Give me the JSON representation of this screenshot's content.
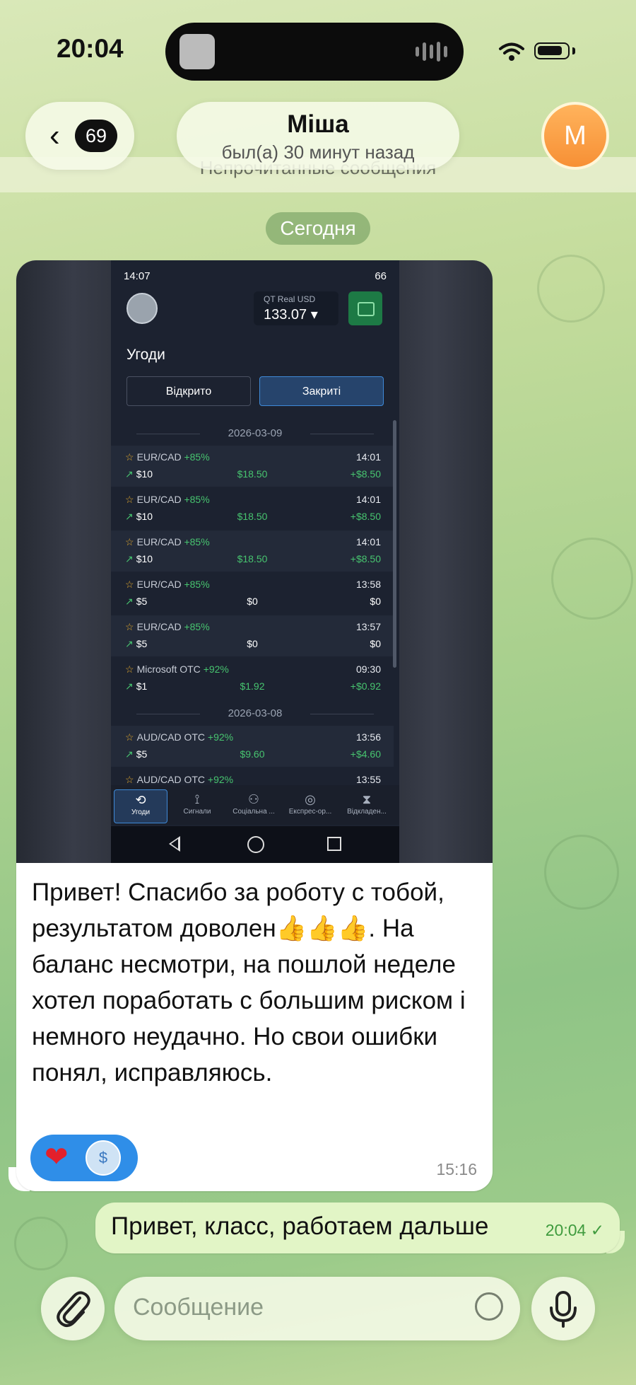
{
  "status_bar": {
    "time": "20:04"
  },
  "header": {
    "back_badge": "69",
    "contact_name": "Міша",
    "contact_status": "был(а) 30 минут назад",
    "avatar_letter": "M"
  },
  "unread_banner": "Непрочитанные сообщения",
  "date_separator": "Сегодня",
  "incoming_message": {
    "screenshot": {
      "status_time": "14:07",
      "status_right": "66",
      "account_label": "QT Real  USD",
      "account_balance": "133.07 ▾",
      "screen_title": "Угоди",
      "tab_open": "Відкрито",
      "tab_closed": "Закриті",
      "groups": [
        {
          "date": "2026-03-09"
        },
        {
          "date": "2026-03-08"
        }
      ],
      "trades": [
        {
          "asset": "EUR/CAD",
          "pct": "+85%",
          "time": "14:01",
          "amount": "$10",
          "payout": "$18.50",
          "profit": "+$8.50"
        },
        {
          "asset": "EUR/CAD",
          "pct": "+85%",
          "time": "14:01",
          "amount": "$10",
          "payout": "$18.50",
          "profit": "+$8.50"
        },
        {
          "asset": "EUR/CAD",
          "pct": "+85%",
          "time": "14:01",
          "amount": "$10",
          "payout": "$18.50",
          "profit": "+$8.50"
        },
        {
          "asset": "EUR/CAD",
          "pct": "+85%",
          "time": "13:58",
          "amount": "$5",
          "payout": "$0",
          "profit": "$0"
        },
        {
          "asset": "EUR/CAD",
          "pct": "+85%",
          "time": "13:57",
          "amount": "$5",
          "payout": "$0",
          "profit": "$0"
        },
        {
          "asset": "Microsoft OTC",
          "pct": "+92%",
          "time": "09:30",
          "amount": "$1",
          "payout": "$1.92",
          "profit": "+$0.92"
        },
        {
          "asset": "AUD/CAD OTC",
          "pct": "+92%",
          "time": "13:56",
          "amount": "$5",
          "payout": "$9.60",
          "profit": "+$4.60"
        },
        {
          "asset": "AUD/CAD OTC",
          "pct": "+92%",
          "time": "13:55",
          "amount": "",
          "payout": "",
          "profit": ""
        }
      ],
      "bottom_nav": [
        "Угоди",
        "Сигнали",
        "Соціальна ...",
        "Експрес-ор...",
        "Відкладен..."
      ]
    },
    "text": "Привет! Спасибо за роботу с тобой, результатом доволен👍👍👍. На баланс несмотри, на пошлой неделе хотел поработать с большим риском і немного неудачно. Но свои ошибки понял, исправляюсь.",
    "reaction": "❤",
    "time": "15:16"
  },
  "outgoing_message": {
    "text": "Привет, класс, работаем дальше",
    "time": "20:04",
    "check": "✓"
  },
  "input_bar": {
    "placeholder": "Сообщение"
  },
  "colors": {
    "accent_blue": "#2f8ee8",
    "outgoing_bubble": "#e2f5c6",
    "date_pill": "#7aa868"
  }
}
